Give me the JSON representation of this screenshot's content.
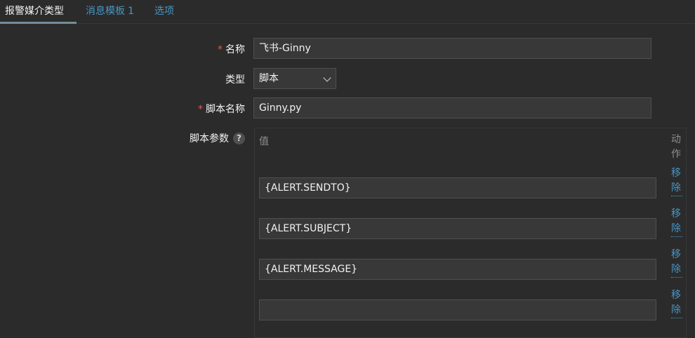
{
  "tabs": [
    {
      "label": "报警媒介类型",
      "count": ""
    },
    {
      "label": "消息模板",
      "count": "1"
    },
    {
      "label": "选项",
      "count": ""
    }
  ],
  "form": {
    "name_label": "名称",
    "name_value": "飞书-Ginny",
    "type_label": "类型",
    "type_value": "脚本",
    "script_name_label": "脚本名称",
    "script_name_value": "Ginny.py",
    "params_label": "脚本参数",
    "help_symbol": "?",
    "required_mark": "*"
  },
  "params_table": {
    "value_header": "值",
    "action_header": "动作",
    "remove_label": "移除",
    "rows": [
      "{ALERT.SENDTO}",
      "{ALERT.SUBJECT}",
      "{ALERT.MESSAGE}",
      ""
    ]
  },
  "colors": {
    "background": "#2b2b2b",
    "field_bg": "#383838",
    "link": "#4796c4",
    "required": "#e45959"
  }
}
